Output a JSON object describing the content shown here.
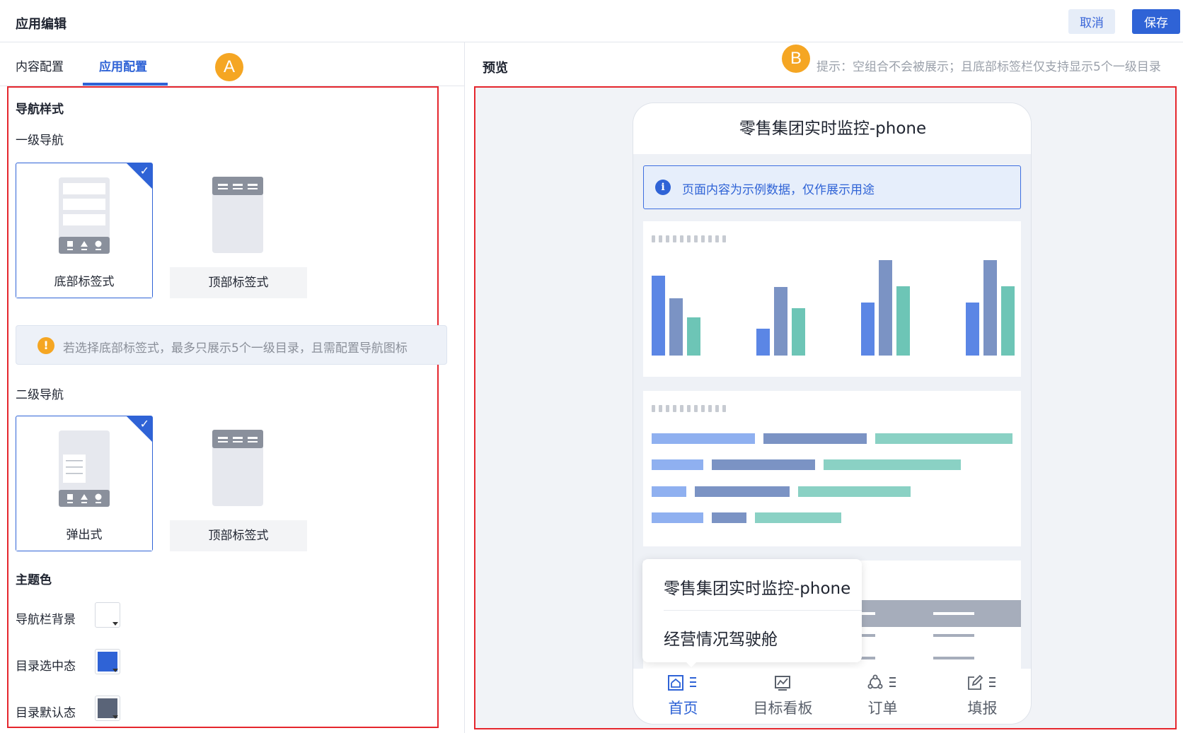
{
  "header": {
    "title": "应用编辑",
    "cancel_label": "取消",
    "save_label": "保存"
  },
  "left": {
    "tabs": [
      {
        "label": "内容配置"
      },
      {
        "label": "应用配置"
      }
    ],
    "badge": "A",
    "nav_style_title": "导航样式",
    "primary_nav_label": "一级导航",
    "primary_options": [
      {
        "label": "底部标签式",
        "selected": true
      },
      {
        "label": "顶部标签式",
        "selected": false
      }
    ],
    "warning": "若选择底部标签式，最多只展示5个一级目录，且需配置导航图标",
    "secondary_nav_label": "二级导航",
    "secondary_options": [
      {
        "label": "弹出式",
        "selected": true
      },
      {
        "label": "顶部标签式",
        "selected": false
      }
    ],
    "theme_title": "主题色",
    "theme_colors": [
      {
        "label": "导航栏背景",
        "color": "#ffffff"
      },
      {
        "label": "目录选中态",
        "color": "#2f63d6"
      },
      {
        "label": "目录默认态",
        "color": "#5a6478"
      }
    ]
  },
  "preview": {
    "title": "预览",
    "badge": "B",
    "hint": "提示：空组合不会被展示；且底部标签栏仅支持显示5个一级目录",
    "phone_title": "零售集团实时监控-phone",
    "info_text": "页面内容为示例数据，仅作展示用途",
    "popup_items": [
      "零售集团实时监控-phone",
      "经营情况驾驶舱"
    ],
    "tabbar": [
      {
        "label": "首页",
        "icon": "home-icon",
        "active": true
      },
      {
        "label": "目标看板",
        "icon": "chart-board-icon",
        "active": false
      },
      {
        "label": "订单",
        "icon": "order-icon",
        "active": false
      },
      {
        "label": "填报",
        "icon": "edit-icon",
        "active": false
      }
    ],
    "colors": {
      "series1": "#5b86e5",
      "series2": "#7b93c4",
      "series3": "#6dc5b6"
    }
  }
}
